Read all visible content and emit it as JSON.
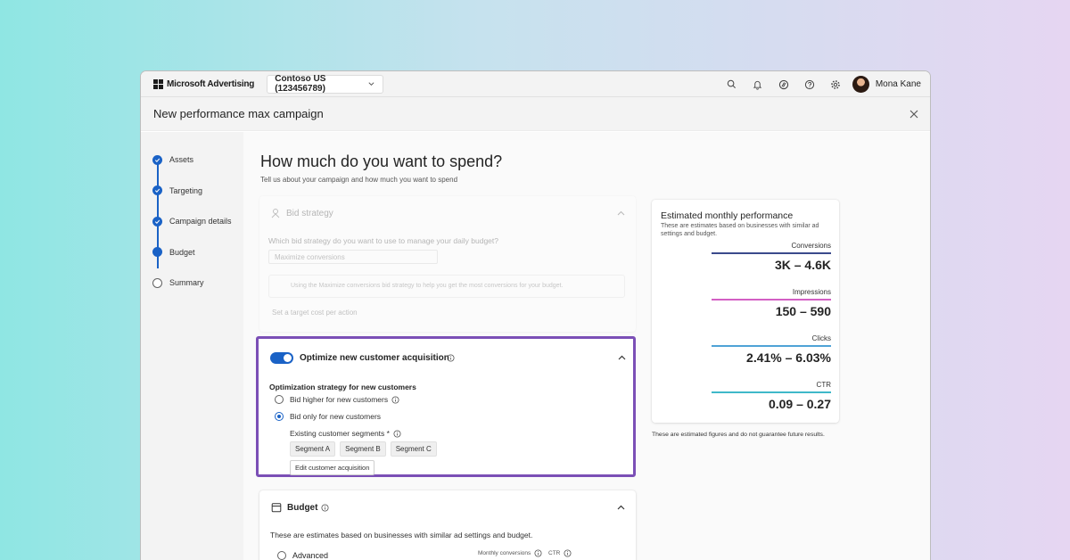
{
  "app": {
    "brand": "Microsoft Advertising",
    "account": "Contoso US (123456789)",
    "user_name": "Mona Kane"
  },
  "page": {
    "title": "New performance max campaign",
    "heading": "How much do you want to spend?",
    "subheading": "Tell us about your campaign and how much you want to spend"
  },
  "steps": [
    {
      "label": "Assets",
      "status": "complete"
    },
    {
      "label": "Targeting",
      "status": "complete"
    },
    {
      "label": "Campaign details",
      "status": "complete"
    },
    {
      "label": "Budget",
      "status": "current"
    },
    {
      "label": "Summary",
      "status": "pending"
    }
  ],
  "bid_strategy": {
    "title": "Bid strategy",
    "question": "Which bid strategy do you want to use to manage your daily budget?",
    "selected": "Maximize conversions",
    "note": "Using the Maximize conversions bid strategy to help you get the most conversions for your budget.",
    "target_option": "Set a target cost per action"
  },
  "optimize": {
    "title": "Optimize new customer acquisition",
    "enabled": true,
    "strategy_label": "Optimization strategy for new customers",
    "options": [
      {
        "label": "Bid higher for new customers",
        "selected": false
      },
      {
        "label": "Bid only for new customers",
        "selected": true
      }
    ],
    "segments_label": "Existing customer segments *",
    "segments": [
      "Segment A",
      "Segment B",
      "Segment C"
    ],
    "edit_label": "Edit customer acquisition"
  },
  "budget": {
    "title": "Budget",
    "description": "These are estimates based on businesses with similar ad settings and budget.",
    "option_label": "Advanced",
    "col_monthly": "Monthly conversions",
    "col_ctr": "CTR"
  },
  "performance": {
    "title": "Estimated monthly performance",
    "description": "These are estimates based on businesses with similar ad settings and budget.",
    "metrics": [
      {
        "label": "Conversions",
        "value": "3K – 4.6K",
        "color": "#3b4a8c"
      },
      {
        "label": "Impressions",
        "value": "150 – 590",
        "color": "#d35fc4"
      },
      {
        "label": "Clicks",
        "value": "2.41% – 6.03%",
        "color": "#4fa3d6"
      },
      {
        "label": "CTR",
        "value": "0.09 – 0.27",
        "color": "#3fb8c9"
      }
    ],
    "footnote": "These are estimated figures and do not guarantee future results."
  },
  "colors": {
    "accent": "#1a62c6",
    "highlight_border": "#7b4fb6"
  }
}
